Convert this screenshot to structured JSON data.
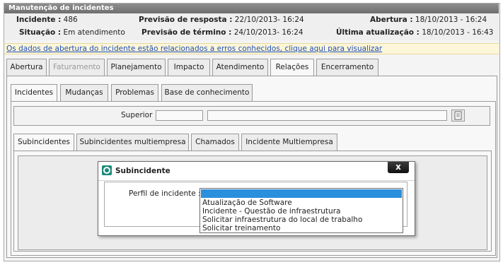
{
  "window": {
    "title": "Manutenção de incidentes"
  },
  "header": {
    "incidente_label": "Incidente :",
    "incidente_value": "486",
    "situacao_label": "Situação :",
    "situacao_value": "Em atendimento",
    "prev_resposta_label": "Previsão de resposta :",
    "prev_resposta_value": "22/10/2013- 16:24",
    "prev_termino_label": "Previsão de término :",
    "prev_termino_value": "24/10/2013- 16:24",
    "abertura_label": "Abertura :",
    "abertura_value": "18/10/2013 - 16:24",
    "ultima_label": "Última atualização :",
    "ultima_value": "18/10/2013 - 16:43"
  },
  "notice": {
    "text": "Os dados de abertura do incidente estão relacionados a erros conhecidos, clique aqui para visualizar"
  },
  "main_tabs": [
    {
      "label": "Abertura"
    },
    {
      "label": "Faturamento"
    },
    {
      "label": "Planejamento"
    },
    {
      "label": "Impacto"
    },
    {
      "label": "Atendimento"
    },
    {
      "label": "Relações"
    },
    {
      "label": "Encerramento"
    }
  ],
  "relation_tabs": [
    {
      "label": "Incidentes"
    },
    {
      "label": "Mudanças"
    },
    {
      "label": "Problemas"
    },
    {
      "label": "Base de conhecimento"
    }
  ],
  "superior": {
    "label": "Superior :"
  },
  "sub_tabs": [
    {
      "label": "Subincidentes"
    },
    {
      "label": "Subincidentes multiempresa"
    },
    {
      "label": "Chamados"
    },
    {
      "label": "Incidente Multiempresa"
    }
  ],
  "modal": {
    "title": "Subincidente",
    "close": "x",
    "perfil_label": "Perfil de incidente :",
    "options": [
      "Atualização de Software",
      "Incidente - Questão de infraestrutura",
      "Solicitar infraestrutura do local de trabalho",
      "Solicitar treinamento"
    ]
  },
  "colors": {
    "title_bar": "#7a7a7a",
    "notice_bg": "#fdf6d8",
    "link": "#1f4fb8",
    "selection": "#2a8fdc"
  }
}
